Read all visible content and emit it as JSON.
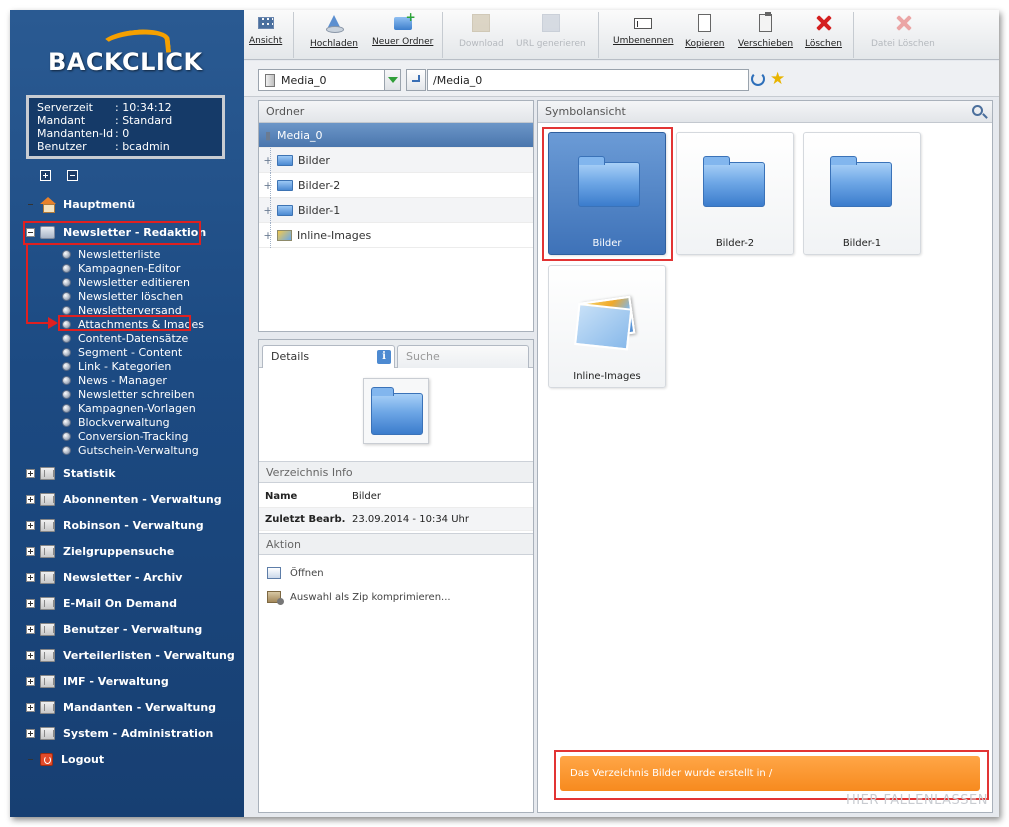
{
  "logo": {
    "text": "BACKCLICK"
  },
  "server_info": [
    {
      "key": "Serverzeit",
      "value": ": 10:34:12"
    },
    {
      "key": "Mandant",
      "value": ": Standard"
    },
    {
      "key": "Mandanten-Id",
      "value": ": 0"
    },
    {
      "key": "Benutzer",
      "value": ": bcadmin"
    }
  ],
  "nav": {
    "hauptmenu": "Hauptmenü",
    "newsletter_redaktion": "Newsletter - Redaktion",
    "sub_items": [
      "Newsletterliste",
      "Kampagnen-Editor",
      "Newsletter editieren",
      "Newsletter löschen",
      "Newsletterversand",
      "Attachments & Images",
      "Content-Datensätze",
      "Segment - Content",
      "Link - Kategorien",
      "News - Manager",
      "Newsletter schreiben",
      "Kampagnen-Vorlagen",
      "Blockverwaltung",
      "Conversion-Tracking",
      "Gutschein-Verwaltung"
    ],
    "sections": [
      "Statistik",
      "Abonnenten - Verwaltung",
      "Robinson - Verwaltung",
      "Zielgruppensuche",
      "Newsletter - Archiv",
      "E-Mail On Demand",
      "Benutzer - Verwaltung",
      "Verteilerlisten - Verwaltung",
      "IMF - Verwaltung",
      "Mandanten - Verwaltung",
      "System - Administration"
    ],
    "logout": "Logout"
  },
  "toolbar": {
    "ansicht": "Ansicht",
    "hochladen": "Hochladen",
    "neuer_ordner": "Neuer Ordner",
    "download": "Download",
    "url_generieren": "URL generieren",
    "umbenennen": "Umbenennen",
    "kopieren": "Kopieren",
    "verschieben": "Verschieben",
    "loeschen": "Löschen",
    "datei_loeschen": "Datei Löschen"
  },
  "pathbar": {
    "select_value": "Media_0",
    "path_value": "/Media_0"
  },
  "ordner": {
    "title": "Ordner",
    "items": [
      "Media_0",
      "Bilder",
      "Bilder-2",
      "Bilder-1",
      "Inline-Images"
    ]
  },
  "details": {
    "tab_details": "Details",
    "tab_suche": "Suche",
    "verzeichnis_info": "Verzeichnis Info",
    "name_label": "Name",
    "name_value": "Bilder",
    "bearb_label": "Zuletzt Bearb.",
    "bearb_value": "23.09.2014 - 10:34 Uhr",
    "aktion": "Aktion",
    "oeffnen": "Öffnen",
    "zip": "Auswahl als Zip komprimieren..."
  },
  "symbol": {
    "title": "Symbolansicht",
    "tiles": [
      "Bilder",
      "Bilder-2",
      "Bilder-1",
      "Inline-Images"
    ]
  },
  "notice": "Das Verzeichnis Bilder wurde erstellt in /",
  "drop_hint": "HIER FALLENLASSEN",
  "colors": {
    "accent": "#3e72b8",
    "notice": "#f78a1e",
    "highlight": "#e02020"
  }
}
